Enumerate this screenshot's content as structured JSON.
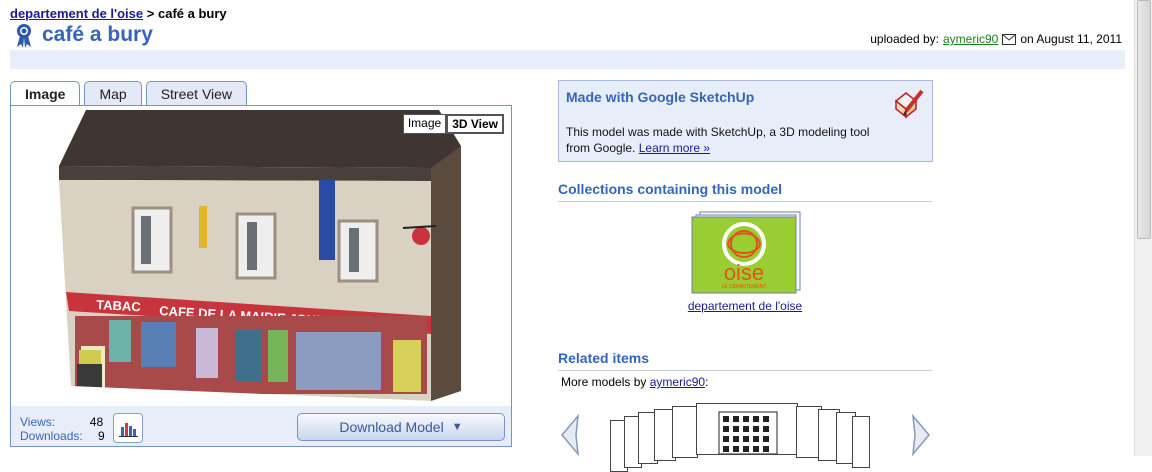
{
  "breadcrumb": {
    "parent": "departement de l'oise",
    "sep": ">",
    "current": "café a bury"
  },
  "title": "café a bury",
  "uploaded": {
    "prefix": "uploaded by:",
    "user": "aymeric90",
    "date_text": "on August 11, 2011"
  },
  "tabs": [
    {
      "label": "Image",
      "active": true
    },
    {
      "label": "Map",
      "active": false
    },
    {
      "label": "Street View",
      "active": false
    }
  ],
  "view_toggle": {
    "image": "Image",
    "threed": "3D View",
    "selected": "3D View"
  },
  "model_scene": {
    "sign_left": "TABAC",
    "sign_main": "CAFE DE LA MAIRIE JOURNAUX"
  },
  "stats": {
    "views_label": "Views:",
    "views": "48",
    "downloads_label": "Downloads:",
    "downloads": "9"
  },
  "download": {
    "label": "Download Model",
    "arrow": "▼"
  },
  "sketchup": {
    "title": "Made with Google SketchUp",
    "text": "This model was made with SketchUp, a 3D modeling tool from Google.",
    "link": "Learn more »"
  },
  "collections": {
    "heading": "Collections containing this model",
    "logo_text": "oise",
    "logo_sub": "LE DÉPARTEMENT",
    "link": "departement de l'oise"
  },
  "related": {
    "heading": "Related items",
    "more_prefix": "More models by",
    "user": "aymeric90",
    "more_suffix": ":"
  },
  "colors": {
    "accent": "#3366bb",
    "panel": "#e8eef9",
    "link": "#1a1a9a",
    "user_link": "#1e7e1e",
    "oise_green": "#9acd32",
    "oise_orange": "#e2541b"
  }
}
